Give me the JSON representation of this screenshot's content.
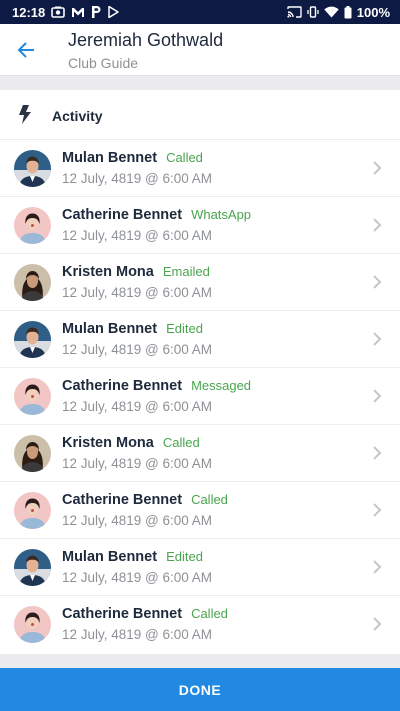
{
  "status_bar": {
    "time": "12:18",
    "battery": "100%",
    "left_icons": [
      "photo-icon",
      "gmail-icon",
      "parking-icon",
      "play-store-icon"
    ],
    "right_icons": [
      "cast-icon",
      "vibrate-icon",
      "wifi-icon",
      "battery-icon"
    ]
  },
  "header": {
    "title": "Jeremiah Gothwald",
    "subtitle": "Club Guide"
  },
  "section": {
    "title": "Activity",
    "icon": "lightning-bolt-icon"
  },
  "activities": [
    {
      "name": "Mulan Bennet",
      "action": "Called",
      "time": "12 July, 4819 @ 6:00 AM",
      "avatar": "man-avatar"
    },
    {
      "name": "Catherine Bennet",
      "action": "WhatsApp",
      "time": "12 July, 4819 @ 6:00 AM",
      "avatar": "woman-pink-avatar"
    },
    {
      "name": "Kristen Mona",
      "action": "Emailed",
      "time": "12 July, 4819 @ 6:00 AM",
      "avatar": "woman-dark-avatar"
    },
    {
      "name": "Mulan Bennet",
      "action": "Edited",
      "time": "12 July, 4819 @ 6:00 AM",
      "avatar": "man-avatar"
    },
    {
      "name": "Catherine Bennet",
      "action": "Messaged",
      "time": "12 July, 4819 @ 6:00 AM",
      "avatar": "woman-pink-avatar"
    },
    {
      "name": "Kristen Mona",
      "action": "Called",
      "time": "12 July, 4819 @ 6:00 AM",
      "avatar": "woman-dark-avatar"
    },
    {
      "name": "Catherine Bennet",
      "action": "Called",
      "time": "12 July, 4819 @ 6:00 AM",
      "avatar": "woman-pink-avatar"
    },
    {
      "name": "Mulan Bennet",
      "action": "Edited",
      "time": "12 July, 4819 @ 6:00 AM",
      "avatar": "man-avatar"
    },
    {
      "name": "Catherine Bennet",
      "action": "Called",
      "time": "12 July, 4819 @ 6:00 AM",
      "avatar": "woman-pink-avatar"
    }
  ],
  "footer": {
    "done_label": "DONE"
  },
  "colors": {
    "status_bar": "#0d1a44",
    "accent": "#2289e2",
    "action_green": "#4aa54e",
    "title_text": "#1e2a3c",
    "muted_text": "#8e9196"
  }
}
